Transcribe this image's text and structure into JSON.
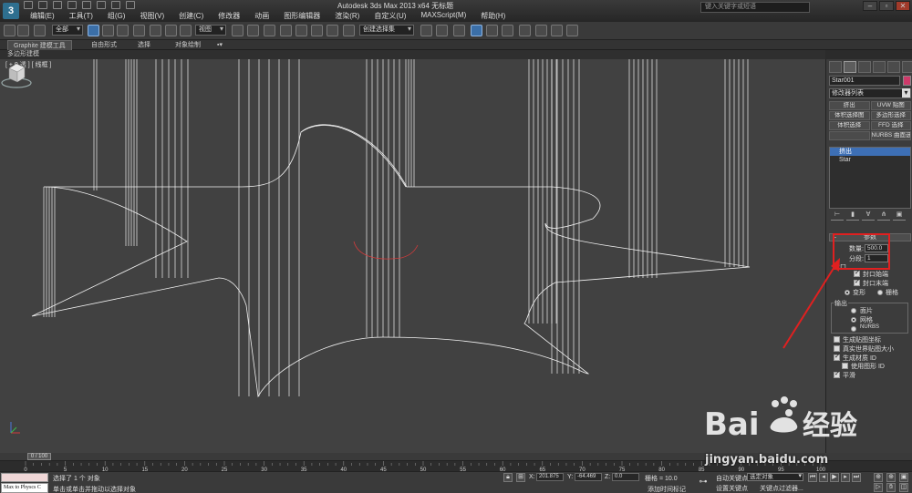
{
  "window": {
    "title": "Autodesk 3ds Max  2013 x64     无标题",
    "search_placeholder": "键入关键字或短语"
  },
  "menu": [
    "编辑(E)",
    "工具(T)",
    "组(G)",
    "视图(V)",
    "创建(C)",
    "修改器",
    "动画",
    "图形编辑器",
    "渲染(R)",
    "自定义(U)",
    "MAXScript(M)",
    "帮助(H)"
  ],
  "toolbar": {
    "selection_filter": "全部",
    "ref_coord": "视图",
    "named_selection": "创建选择集"
  },
  "ribbon": {
    "tabs": [
      "Graphite 建模工具",
      "自由形式",
      "选择",
      "对象绘制"
    ],
    "active_tab": 0,
    "sub_label": "多边形建模"
  },
  "viewport": {
    "label": "[ + 0 透 ] [ 线框 ]"
  },
  "command_panel": {
    "object_name": "Star001",
    "object_color": "#cf3a6a",
    "modifier_list": "修改器列表",
    "modifier_buttons": [
      "挤出",
      "UVW 贴图",
      "体积选择图",
      "多边形选择",
      "体积选择",
      "FFD 选择",
      "",
      "NURBS 曲面选择"
    ],
    "stack": [
      {
        "label": "挤出",
        "selected": true
      },
      {
        "label": "Star",
        "selected": false
      }
    ],
    "params": {
      "rollout_title": "参数",
      "amount_label": "数量:",
      "amount_value": "500.0",
      "segments_label": "分段:",
      "segments_value": "1",
      "capping_label": "封口",
      "cap_start_label": "封口始端",
      "cap_start": true,
      "cap_end_label": "封口末端",
      "cap_end": true,
      "morph_label": "变形",
      "grid_label": "栅格",
      "cap_type": "morph",
      "output_label": "输出",
      "output_options": [
        "面片",
        "网格",
        "NURBS"
      ],
      "output_selected": 1,
      "gen_mapping_label": "生成贴图坐标",
      "gen_mapping": false,
      "real_world_label": "真实世界贴图大小",
      "real_world": false,
      "gen_matid_label": "生成材质 ID",
      "gen_matid": true,
      "use_shape_id_label": "使用图形 ID",
      "use_shape_id": false,
      "smooth_label": "平滑",
      "smooth": true
    }
  },
  "timeline": {
    "frame_display": "0 / 100",
    "ticks": [
      0,
      5,
      10,
      15,
      20,
      25,
      30,
      35,
      40,
      45,
      50,
      55,
      60,
      65,
      70,
      75,
      80,
      85,
      90,
      95,
      100
    ]
  },
  "status_bar": {
    "maxscript_text": "Max to Physcs C",
    "selected_text": "选择了 1 个 对象",
    "prompt_text": "单击或单击并拖动以选择对象",
    "x_label": "X:",
    "x_value": "201.875",
    "y_label": "Y:",
    "y_value": "-64.469",
    "z_label": "Z:",
    "z_value": "0.0",
    "grid_text": "栅格 = 10.0",
    "auto_key_label": "自动关键点",
    "selected_object": "选定对象",
    "set_key_label": "设置关键点",
    "key_filters_label": "关键点过滤器...",
    "add_time_tag": "添加时间标记"
  },
  "watermark": {
    "brand": "Bai",
    "brand_cn": "经验",
    "url": "jingyan.baidu.com"
  },
  "colors": {
    "accent_blue": "#3b6fa8",
    "annotation_red": "#e02020",
    "viewport_bg": "#414141"
  }
}
